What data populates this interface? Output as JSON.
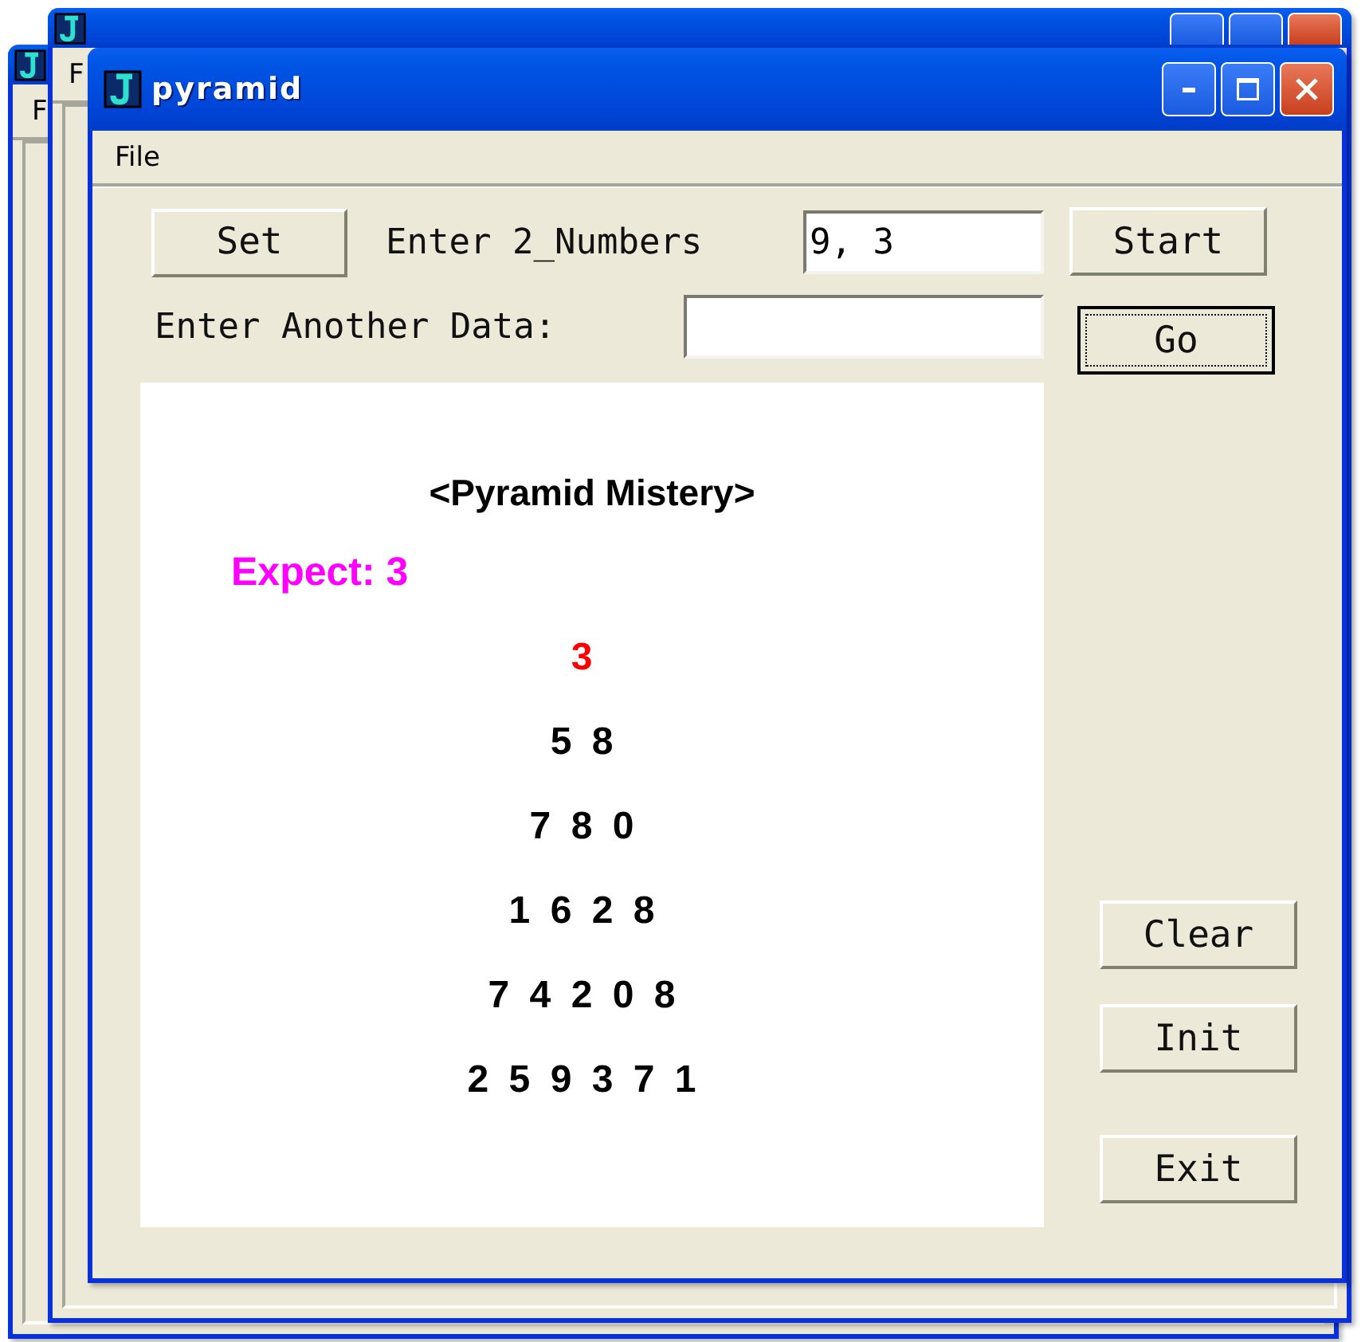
{
  "back_windows": [
    {
      "menu": "F"
    },
    {
      "menu": "F"
    }
  ],
  "window": {
    "title": "pyramid"
  },
  "menu": [
    "File"
  ],
  "set_button": {
    "label": "Set"
  },
  "numbers_label": "Enter 2_Numbers",
  "numbers_field": {
    "value": "9, 3"
  },
  "data_label": "Enter Another Data:",
  "side_buttons": [
    {
      "label": "Start",
      "focused": false
    },
    {
      "label": "Go",
      "focused": true
    },
    {
      "label": "Clear",
      "focused": false
    },
    {
      "label": "Init",
      "focused": false
    },
    {
      "label": "Exit",
      "focused": false
    }
  ],
  "canvas": {
    "heading": "<Pyramid Mistery>",
    "expect": "Expect: 3",
    "rows": [
      {
        "text": "3",
        "color": "#ff0000"
      },
      {
        "text": "5 8",
        "color": "#000000"
      },
      {
        "text": "7 8 0",
        "color": "#000000"
      },
      {
        "text": "1 6 2 8",
        "color": "#000000"
      },
      {
        "text": "7 4 2 0 8",
        "color": "#000000"
      },
      {
        "text": "2 5 9 3 7 1",
        "color": "#000000"
      }
    ]
  }
}
